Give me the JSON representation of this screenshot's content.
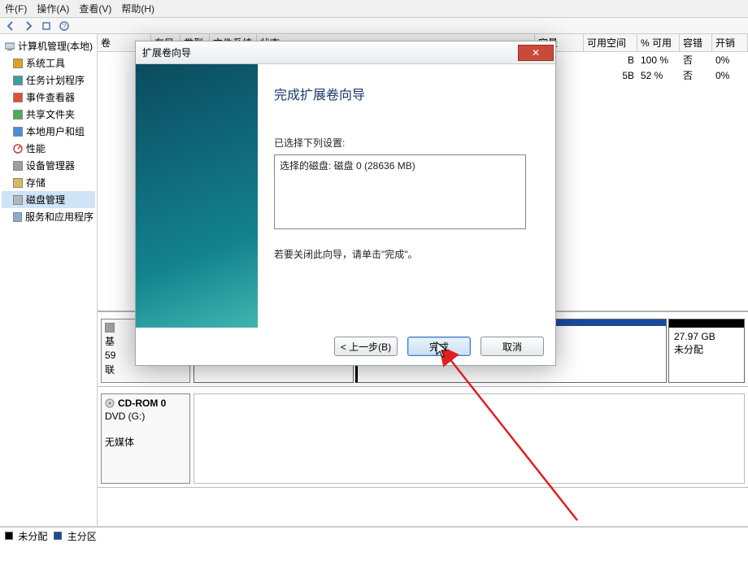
{
  "menubar": {
    "file": "件(F)",
    "action": "操作(A)",
    "view": "查看(V)",
    "help": "帮助(H)"
  },
  "tree": {
    "root": "计算机管理(本地)",
    "sysTools": "系统工具",
    "scheduler": "任务计划程序",
    "eventViewer": "事件查看器",
    "shared": "共享文件夹",
    "localUsers": "本地用户和组",
    "perf": "性能",
    "devmgr": "设备管理器",
    "storage": "存储",
    "diskmgmt": "磁盘管理",
    "services": "服务和应用程序"
  },
  "columns": {
    "vol": "卷",
    "layout": "布局",
    "type": "类型",
    "fs": "文件系统",
    "status": "状态",
    "capacity": "容量",
    "free": "可用空间",
    "pctFree": "% 可用",
    "fault": "容错",
    "overhead": "开销"
  },
  "rows": [
    {
      "freeEnd": "B",
      "pct": "100 %",
      "fault": "否",
      "ovh": "0%"
    },
    {
      "freeEnd": "5B",
      "pct": "52 %",
      "fault": "否",
      "ovh": "0%"
    }
  ],
  "disk0": {
    "label_prefix": "基",
    "sub_prefix": "59",
    "sub_suffix": "联",
    "part_size": "27.97 GB",
    "part_status": "未分配"
  },
  "disk1": {
    "name": "CD-ROM 0",
    "drive": "DVD (G:)",
    "status": "无媒体"
  },
  "legend": {
    "unalloc": "未分配",
    "primary": "主分区"
  },
  "wizard": {
    "title": "扩展卷向导",
    "heading": "完成扩展卷向导",
    "label": "已选择下列设置:",
    "listbox": "选择的磁盘: 磁盘 0 (28636 MB)",
    "note": "若要关闭此向导，请单击\"完成\"。",
    "back": "< 上一步(B)",
    "finish": "完成",
    "cancel": "取消",
    "close": "✕"
  }
}
